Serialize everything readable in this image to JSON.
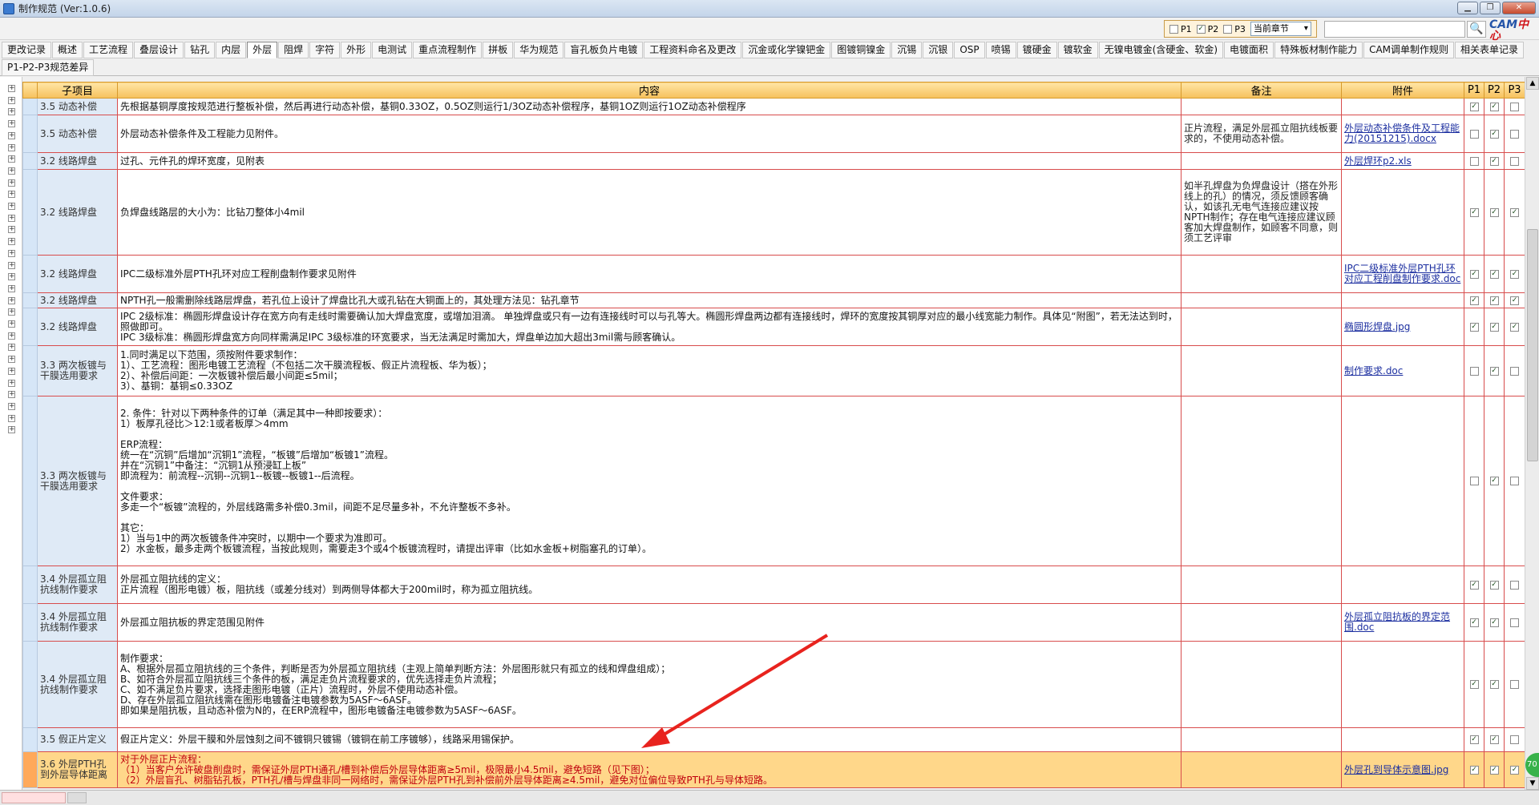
{
  "window": {
    "title": "制作规范 (Ver:1.0.6)"
  },
  "filters": {
    "p1": "P1",
    "p2": "P2",
    "p3": "P3",
    "p1_checked": false,
    "p2_checked": true,
    "p3_checked": false,
    "scope": "当前章节"
  },
  "search": {
    "placeholder": ""
  },
  "logo": {
    "text": "CAM",
    "accent": "中心"
  },
  "tabs": [
    "更改记录",
    "概述",
    "工艺流程",
    "叠层设计",
    "钻孔",
    "内层",
    "外层",
    "阻焊",
    "字符",
    "外形",
    "电测试",
    "重点流程制作",
    "拼板",
    "华为规范",
    "盲孔板负片电镀",
    "工程资料命名及更改",
    "沉金或化学镍钯金",
    "图镀铜镍金",
    "沉锡",
    "沉银",
    "OSP",
    "喷锡",
    "镀硬金",
    "镀软金",
    "无镍电镀金(含硬金、软金)",
    "电镀面积",
    "特殊板材制作能力",
    "CAM调单制作规则",
    "相关表单记录",
    "P1-P2-P3规范差异"
  ],
  "active_tab": "外层",
  "columns": {
    "sub": "子项目",
    "content": "内容",
    "note": "备注",
    "att": "附件",
    "p1": "P1",
    "p2": "P2",
    "p3": "P3"
  },
  "rows": [
    {
      "sub": "3.5 动态补偿",
      "content": "先根据基铜厚度按规范进行整板补偿，然后再进行动态补偿，基铜0.33OZ，0.5OZ则运行1/3OZ动态补偿程序，基铜1OZ则运行1OZ动态补偿程序",
      "note": "",
      "att": "",
      "p1": true,
      "p2": true,
      "p3": false
    },
    {
      "sub": "3.5 动态补偿",
      "content": "外层动态补偿条件及工程能力见附件。",
      "note": "正片流程，满足外层孤立阻抗线板要求的，不使用动态补偿。",
      "att": "外层动态补偿条件及工程能力(20151215).docx",
      "p1": false,
      "p2": true,
      "p3": false
    },
    {
      "sub": "3.2 线路焊盘",
      "content": "过孔、元件孔的焊环宽度，见附表",
      "note": "",
      "att": "外层焊环p2.xls",
      "p1": false,
      "p2": true,
      "p3": false
    },
    {
      "sub": "3.2 线路焊盘",
      "content": "负焊盘线路层的大小为：比钻刀整体小4mil",
      "note": "如半孔焊盘为负焊盘设计（搭在外形线上的孔）的情况，须反馈顾客确认，如该孔无电气连接应建议按NPTH制作；存在电气连接应建议顾客加大焊盘制作，如顾客不同意，则须工艺评审",
      "att": "",
      "p1": true,
      "p2": true,
      "p3": true
    },
    {
      "sub": "3.2 线路焊盘",
      "content": "IPC二级标准外层PTH孔环对应工程削盘制作要求见附件",
      "note": "",
      "att": "IPC二级标准外层PTH孔环对应工程削盘制作要求.doc",
      "p1": true,
      "p2": true,
      "p3": true
    },
    {
      "sub": "3.2 线路焊盘",
      "content": "NPTH孔一般需删除线路层焊盘，若孔位上设计了焊盘比孔大或孔钻在大铜面上的，其处理方法见：钻孔章节",
      "note": "",
      "att": "",
      "p1": true,
      "p2": true,
      "p3": true
    },
    {
      "sub": "3.2 线路焊盘",
      "content": "IPC 2级标准：椭圆形焊盘设计存在宽方向有走线时需要确认加大焊盘宽度，或增加泪滴。 单独焊盘或只有一边有连接线时可以与孔等大。椭圆形焊盘两边都有连接线时，焊环的宽度按其铜厚对应的最小线宽能力制作。具体见“附图”，若无法达到时，照做即可。\nIPC 3级标准：椭圆形焊盘宽方向同样需满足IPC 3级标准的环宽要求，当无法满足时需加大，焊盘单边加大超出3mil需与顾客确认。",
      "note": "",
      "att": "椭圆形焊盘.jpg",
      "p1": true,
      "p2": true,
      "p3": true
    },
    {
      "sub": "3.3 两次板镀与干膜选用要求",
      "content": "1.同时满足以下范围，须按附件要求制作：\n1）、工艺流程：图形电镀工艺流程（不包括二次干膜流程板、假正片流程板、华为板）；\n2）、补偿后间距：一次板镀补偿后最小间距≤5mil；\n3）、基铜：基铜≤0.33OZ",
      "note": "",
      "att": "制作要求.doc",
      "p1": false,
      "p2": true,
      "p3": false
    },
    {
      "sub": "3.3 两次板镀与干膜选用要求",
      "content": "2. 条件：针对以下两种条件的订单（满足其中一种即按要求）：\n1）板厚孔径比＞12:1或者板厚＞4mm\n\nERP流程：\n统一在“沉铜”后增加“沉铜1”流程，“板镀”后增加“板镀1”流程。\n并在“沉铜1”中备注：“沉铜1从预浸缸上板”\n即流程为：前流程--沉铜--沉铜1--板镀--板镀1--后流程。\n\n文件要求：\n多走一个“板镀”流程的，外层线路需多补偿0.3mil，间距不足尽量多补，不允许整板不多补。\n\n其它：\n1）当与1中的两次板镀条件冲突时，以期中一个要求为准即可。\n2）水金板，最多走两个板镀流程，当按此规则，需要走3个或4个板镀流程时，请提出评审（比如水金板+树脂塞孔的订单）。",
      "note": "",
      "att": "",
      "p1": false,
      "p2": true,
      "p3": false
    },
    {
      "sub": "3.4 外层孤立阻抗线制作要求",
      "content": "外层孤立阻抗线的定义：\n正片流程（图形电镀）板，阻抗线（或差分线对）到两侧导体都大于200mil时，称为孤立阻抗线。",
      "note": "",
      "att": "",
      "p1": true,
      "p2": true,
      "p3": false
    },
    {
      "sub": "3.4 外层孤立阻抗线制作要求",
      "content": "外层孤立阻抗板的界定范围见附件",
      "note": "",
      "att": "外层孤立阻抗板的界定范围.doc",
      "p1": true,
      "p2": true,
      "p3": false
    },
    {
      "sub": "3.4 外层孤立阻抗线制作要求",
      "content": "制作要求：\nA、根据外层孤立阻抗线的三个条件，判断是否为外层孤立阻抗线（主观上简单判断方法：外层图形就只有孤立的线和焊盘组成）；\nB、如符合外层孤立阻抗线三个条件的板，满足走负片流程要求的，优先选择走负片流程；\nC、如不满足负片要求，选择走图形电镀（正片）流程时，外层不使用动态补偿。\nD、存在外层孤立阻抗线需在图形电镀备注电镀参数为5ASF～6ASF。\n即如果是阻抗板，且动态补偿为N的，在ERP流程中，图形电镀备注电镀参数为5ASF～6ASF。",
      "note": "",
      "att": "",
      "p1": true,
      "p2": true,
      "p3": false
    },
    {
      "sub": "3.5 假正片定义",
      "content": "假正片定义：外层干膜和外层蚀刻之间不镀铜只镀锡（镀铜在前工序镀够），线路采用锡保护。",
      "note": "",
      "att": "",
      "p1": true,
      "p2": true,
      "p3": false
    },
    {
      "sub": "3.6 外层PTH孔到外层导体距离",
      "content": "对于外层正片流程：\n（1）当客户允许破盘削盘时，需保证外层PTH通孔/槽到补偿后外层导体距离≥5mil，极限最小4.5mil，避免短路（见下图）；\n（2）外层盲孔、树脂钻孔板，PTH孔/槽与焊盘非同一网络时，需保证外层PTH孔到补偿前外层导体距离≥4.5mil，避免对位偏位导致PTH孔与导体短路。",
      "note": "",
      "att": "外层孔到导体示意图.jpg",
      "p1": true,
      "p2": true,
      "p3": true
    }
  ],
  "colors": {
    "header": "#f6c15c",
    "grid_border": "#d84c4c",
    "highlight": "#ffd78a",
    "highlight_text": "#c0000d",
    "arrow": "#e8231e"
  }
}
